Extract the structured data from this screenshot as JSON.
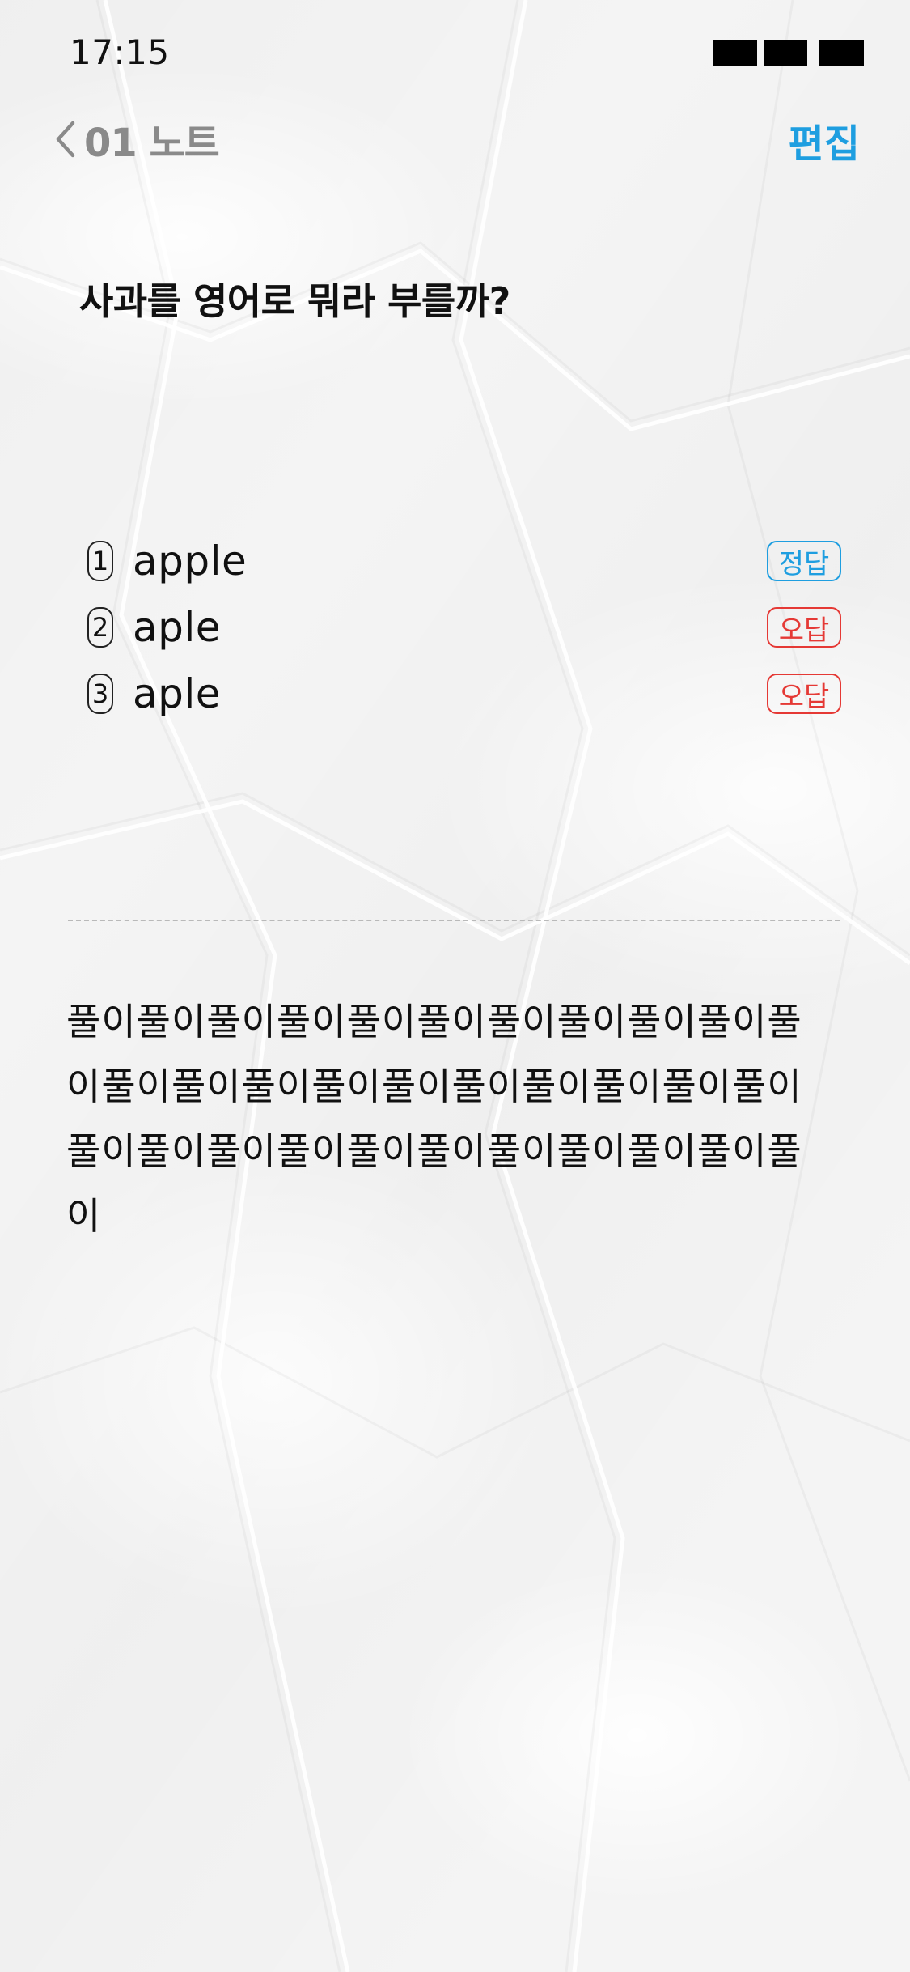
{
  "status_bar": {
    "time": "17:15",
    "icons": [
      "signal-icon",
      "wifi-icon",
      "battery-icon"
    ]
  },
  "nav": {
    "back_label": "01 노트",
    "back_icon": "chevron-left-icon",
    "edit_label": "편집"
  },
  "question": {
    "text": "사과를 영어로 뭐라 부를까?"
  },
  "choices": [
    {
      "number": "1",
      "text": "apple",
      "result": "정답",
      "status": "correct"
    },
    {
      "number": "2",
      "text": "aple",
      "result": "오답",
      "status": "wrong"
    },
    {
      "number": "3",
      "text": "aple",
      "result": "오답",
      "status": "wrong"
    }
  ],
  "explanation": {
    "text": "풀이풀이풀이풀이풀이풀이풀이풀이풀이풀이풀이풀이풀이풀이풀이풀이풀이풀이풀이풀이풀이풀이풀이풀이풀이풀이풀이풀이풀이풀이풀이풀이"
  },
  "colors": {
    "accent": "#1e9ee0",
    "correct": "#1e9ee0",
    "wrong": "#e53935",
    "nav_back": "#8a8a8a",
    "text": "#111111"
  }
}
